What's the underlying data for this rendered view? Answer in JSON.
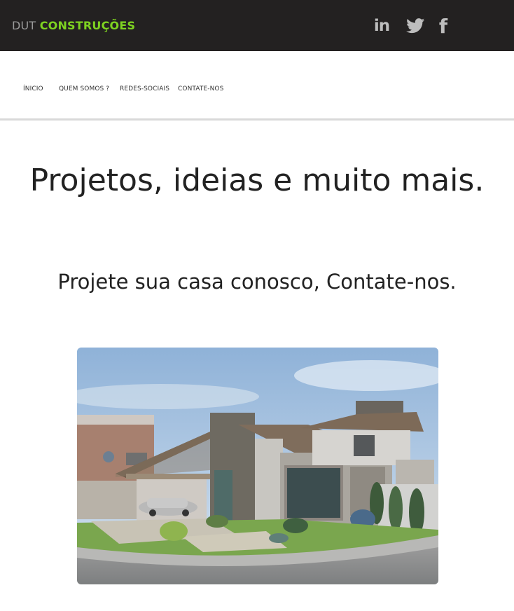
{
  "header": {
    "brand_prefix": "DUT",
    "brand_name": "CONSTRUÇÕES",
    "social": [
      {
        "name": "linkedin",
        "icon": "linkedin-icon",
        "glyph": "in"
      },
      {
        "name": "twitter",
        "icon": "twitter-icon"
      },
      {
        "name": "facebook",
        "icon": "facebook-icon",
        "glyph": "f"
      }
    ]
  },
  "nav": {
    "items": [
      "ÍNICIO",
      "QUEM SOMOS ?",
      "REDES-SOCIAIS",
      "CONTATE-NOS"
    ]
  },
  "main": {
    "headline": "Projetos, ideias e muito mais.",
    "subheadline": "Projete sua casa conosco, Contate-nos.",
    "image_alt": "house rendering"
  },
  "colors": {
    "topbar_bg": "#232121",
    "brand_accent": "#7ed321",
    "icon_gray": "#bdbdbd"
  }
}
